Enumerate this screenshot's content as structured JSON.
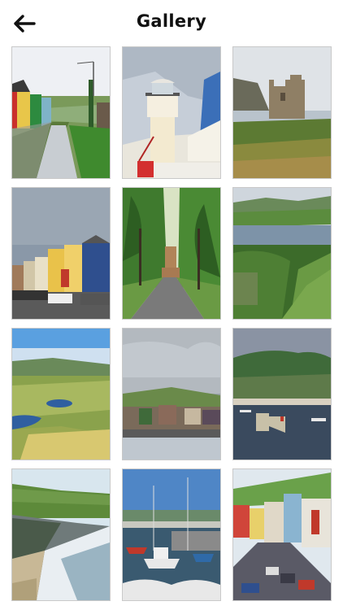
{
  "header": {
    "title": "Gallery",
    "back_icon": "arrow-left-icon"
  },
  "gallery": {
    "photos": [
      {
        "subject": "village-street-canal",
        "colors": [
          "#eef0f4",
          "#2d8a3f",
          "#7fb38a",
          "#c9302c"
        ]
      },
      {
        "subject": "lighthouse",
        "colors": [
          "#b9c5d6",
          "#f5efe0",
          "#d32f2f",
          "#3b6fb8"
        ]
      },
      {
        "subject": "castle-ruins",
        "colors": [
          "#dfe3e7",
          "#8a8a6a",
          "#5c7a33",
          "#a68d6a"
        ]
      },
      {
        "subject": "colorful-houses-street",
        "colors": [
          "#8a98a8",
          "#e9c24a",
          "#2f4f8e",
          "#6a6a6a"
        ]
      },
      {
        "subject": "tree-lined-road",
        "colors": [
          "#d9e3c4",
          "#3f7a2e",
          "#7a7a7a",
          "#b18458"
        ]
      },
      {
        "subject": "bay-and-hills",
        "colors": [
          "#cfd6dd",
          "#5b8c3e",
          "#7d93a8",
          "#3c6b2a"
        ]
      },
      {
        "subject": "green-valley-lakes",
        "colors": [
          "#5aa0e0",
          "#8aa24c",
          "#2f5fa0",
          "#d8c870"
        ]
      },
      {
        "subject": "cloudy-harbour-town",
        "colors": [
          "#9aa2aa",
          "#6a8a4a",
          "#8a6a5a",
          "#bfc7cf"
        ]
      },
      {
        "subject": "harbour-marina",
        "colors": [
          "#7b8a9a",
          "#3f6a3a",
          "#3a4a5e",
          "#d8d0c0"
        ]
      },
      {
        "subject": "beach-coast",
        "colors": [
          "#d8e6ee",
          "#5d8a3a",
          "#e9e2d2",
          "#6f7a7a"
        ]
      },
      {
        "subject": "fishing-boats",
        "colors": [
          "#4f86c6",
          "#3a5a70",
          "#e8e8e8",
          "#c0392b"
        ]
      },
      {
        "subject": "hillside-town-street",
        "colors": [
          "#6aa14a",
          "#e0d8c8",
          "#d0453a",
          "#3a3a46"
        ]
      }
    ]
  }
}
